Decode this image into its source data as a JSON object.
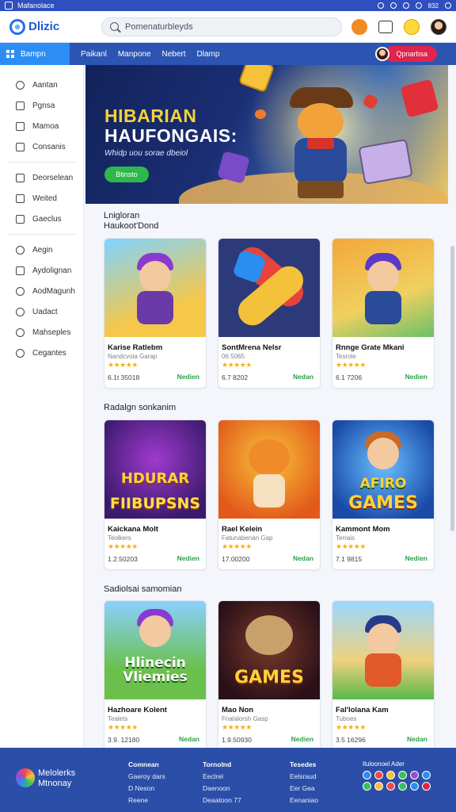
{
  "statusbar": {
    "app_name": "Mafanolace",
    "battery": "832"
  },
  "header": {
    "logo_text": "Dlizic",
    "search_placeholder": "Pomenaturbleyds"
  },
  "nav": {
    "first_label": "Bampn",
    "items": [
      "Paikanl",
      "Manpone",
      "Nebert",
      "Dlamp"
    ],
    "user_button": "Qpnarbsa"
  },
  "sidebar": {
    "group1": [
      "Aantan",
      "Pgnsa",
      "Mamoa",
      "Consanis"
    ],
    "group2": [
      "Deorselean",
      "Weited",
      "Gaeclus"
    ],
    "group3": [
      "Aegin",
      "Aydolignan",
      "AodMagunh",
      "Uadact",
      "Mahseples",
      "Cegantes"
    ]
  },
  "hero": {
    "title_line1": "HIBARIAN",
    "title_line2": "HAUFONGAIS:",
    "subtitle": "Whidp uou sorae dbeiol",
    "button": "Btinsto"
  },
  "sections": [
    {
      "title_line1": "Lnigloran",
      "title_line2": "Haukoot'Dond",
      "cards": [
        {
          "name": "Karise Ratlebm",
          "sub": "Nandcvoia Garap",
          "stars": "★★★★★",
          "meta": "6.1t 35018",
          "action": "Nedien"
        },
        {
          "name": "SontMrena Nelsr",
          "sub": "06 5065",
          "stars": "★★★★★",
          "meta": "6.7 8202",
          "action": "Nedan"
        },
        {
          "name": "Rnnge Grate Mkani",
          "sub": "Tesrole",
          "stars": "★★★★★",
          "meta": "6.1 7206",
          "action": "Nedien"
        }
      ]
    },
    {
      "title_line1": "Radalgn sonkanim",
      "title_line2": "",
      "cards": [
        {
          "name": "Kaickana Molt",
          "sub": "Teolkers",
          "stars": "★★★★★",
          "meta": "1.2.50203",
          "action": "Nedien",
          "thumb_text_1": "HDURAR",
          "thumb_text_2": "FIIBUPSNS"
        },
        {
          "name": "Rael Kelein",
          "sub": "Fatunabenan Gap",
          "stars": "★★★★★",
          "meta": "17.00200",
          "action": "Nedan"
        },
        {
          "name": "Kammont Mom",
          "sub": "Terrais",
          "stars": "★★★★★",
          "meta": "7.1 9815",
          "action": "Nedien",
          "thumb_text_1": "AFIRO",
          "thumb_text_2": "GAMES"
        }
      ]
    },
    {
      "title_line1": "Sadiolsai samomian",
      "title_line2": "",
      "cards": [
        {
          "name": "Hazhoare Kolent",
          "sub": "Tealets",
          "stars": "★★★★★",
          "meta": "3.9. 12180",
          "action": "Nedan",
          "thumb_text_1": "Hlinecin",
          "thumb_text_2": "Vliemies"
        },
        {
          "name": "Mao Non",
          "sub": "Fnalalorsh Gasp",
          "stars": "★★★★★",
          "meta": "1.9.50930",
          "action": "Nedien",
          "thumb_text_1": "GAMES"
        },
        {
          "name": "Fal'lolana Kam",
          "sub": "Tuboes",
          "stars": "★★★★★",
          "meta": "3.5 16296",
          "action": "Nedan"
        }
      ]
    }
  ],
  "footer": {
    "brand_line1": "Melolerks",
    "brand_line2": "Mtnonay",
    "col1": {
      "head": "Comnean",
      "items": [
        "Gaeroy dars",
        "D Neson",
        "Reene"
      ]
    },
    "col2": {
      "head": "Tornolnd",
      "items": [
        "Eeclrel",
        "Daenoon",
        "Deaatoon 77"
      ]
    },
    "col3": {
      "head": "Tesedes",
      "items": [
        "Eelsraud",
        "Eer Gea",
        "Eenaniao"
      ]
    },
    "social_head": "Iluloonoel Ader"
  },
  "colors": {
    "accent": "#2c8ef5",
    "nav": "#2c54b3",
    "cta": "#e0244c",
    "play": "#2eb84c",
    "star": "#f2b01e"
  }
}
